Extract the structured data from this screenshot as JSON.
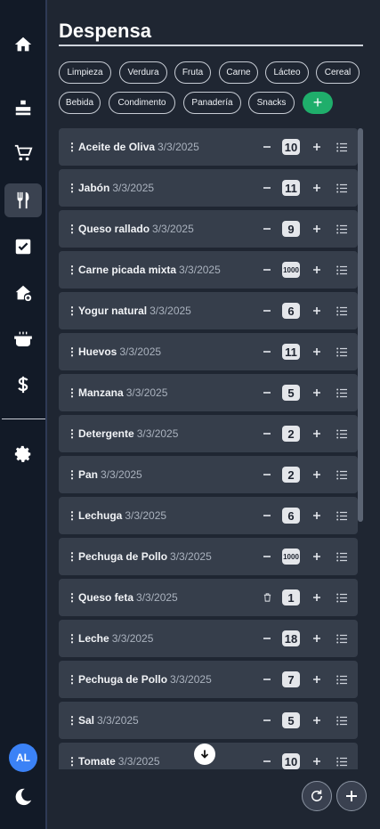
{
  "page": {
    "title": "Despensa"
  },
  "user": {
    "initials": "AL"
  },
  "categories": [
    "Limpieza",
    "Verdura",
    "Fruta",
    "Carne",
    "Lácteo",
    "Cereal",
    "Bebida",
    "Condimento",
    "Panadería",
    "Snacks"
  ],
  "add_category_label": "+",
  "items": [
    {
      "name": "Aceite de Oliva",
      "date": "3/3/2025",
      "qty": "10"
    },
    {
      "name": "Jabón",
      "date": "3/3/2025",
      "qty": "11"
    },
    {
      "name": "Queso rallado",
      "date": "3/3/2025",
      "qty": "9"
    },
    {
      "name": "Carne picada mixta",
      "date": "3/3/2025",
      "qty": "1000"
    },
    {
      "name": "Yogur natural",
      "date": "3/3/2025",
      "qty": "6"
    },
    {
      "name": "Huevos",
      "date": "3/3/2025",
      "qty": "11"
    },
    {
      "name": "Manzana",
      "date": "3/3/2025",
      "qty": "5"
    },
    {
      "name": "Detergente",
      "date": "3/3/2025",
      "qty": "2"
    },
    {
      "name": "Pan",
      "date": "3/3/2025",
      "qty": "2"
    },
    {
      "name": "Lechuga",
      "date": "3/3/2025",
      "qty": "6"
    },
    {
      "name": "Pechuga de Pollo",
      "date": "3/3/2025",
      "qty": "1000"
    },
    {
      "name": "Queso feta",
      "date": "3/3/2025",
      "qty": "1",
      "minus_icon": "trash-icon"
    },
    {
      "name": "Leche",
      "date": "3/3/2025",
      "qty": "18"
    },
    {
      "name": "Pechuga de Pollo",
      "date": "3/3/2025",
      "qty": "7"
    },
    {
      "name": "Sal",
      "date": "3/3/2025",
      "qty": "5"
    },
    {
      "name": "Tomate",
      "date": "3/3/2025",
      "qty": "10"
    }
  ],
  "colors": {
    "accent_green": "#1fae6b",
    "avatar_blue": "#3b82f6"
  }
}
